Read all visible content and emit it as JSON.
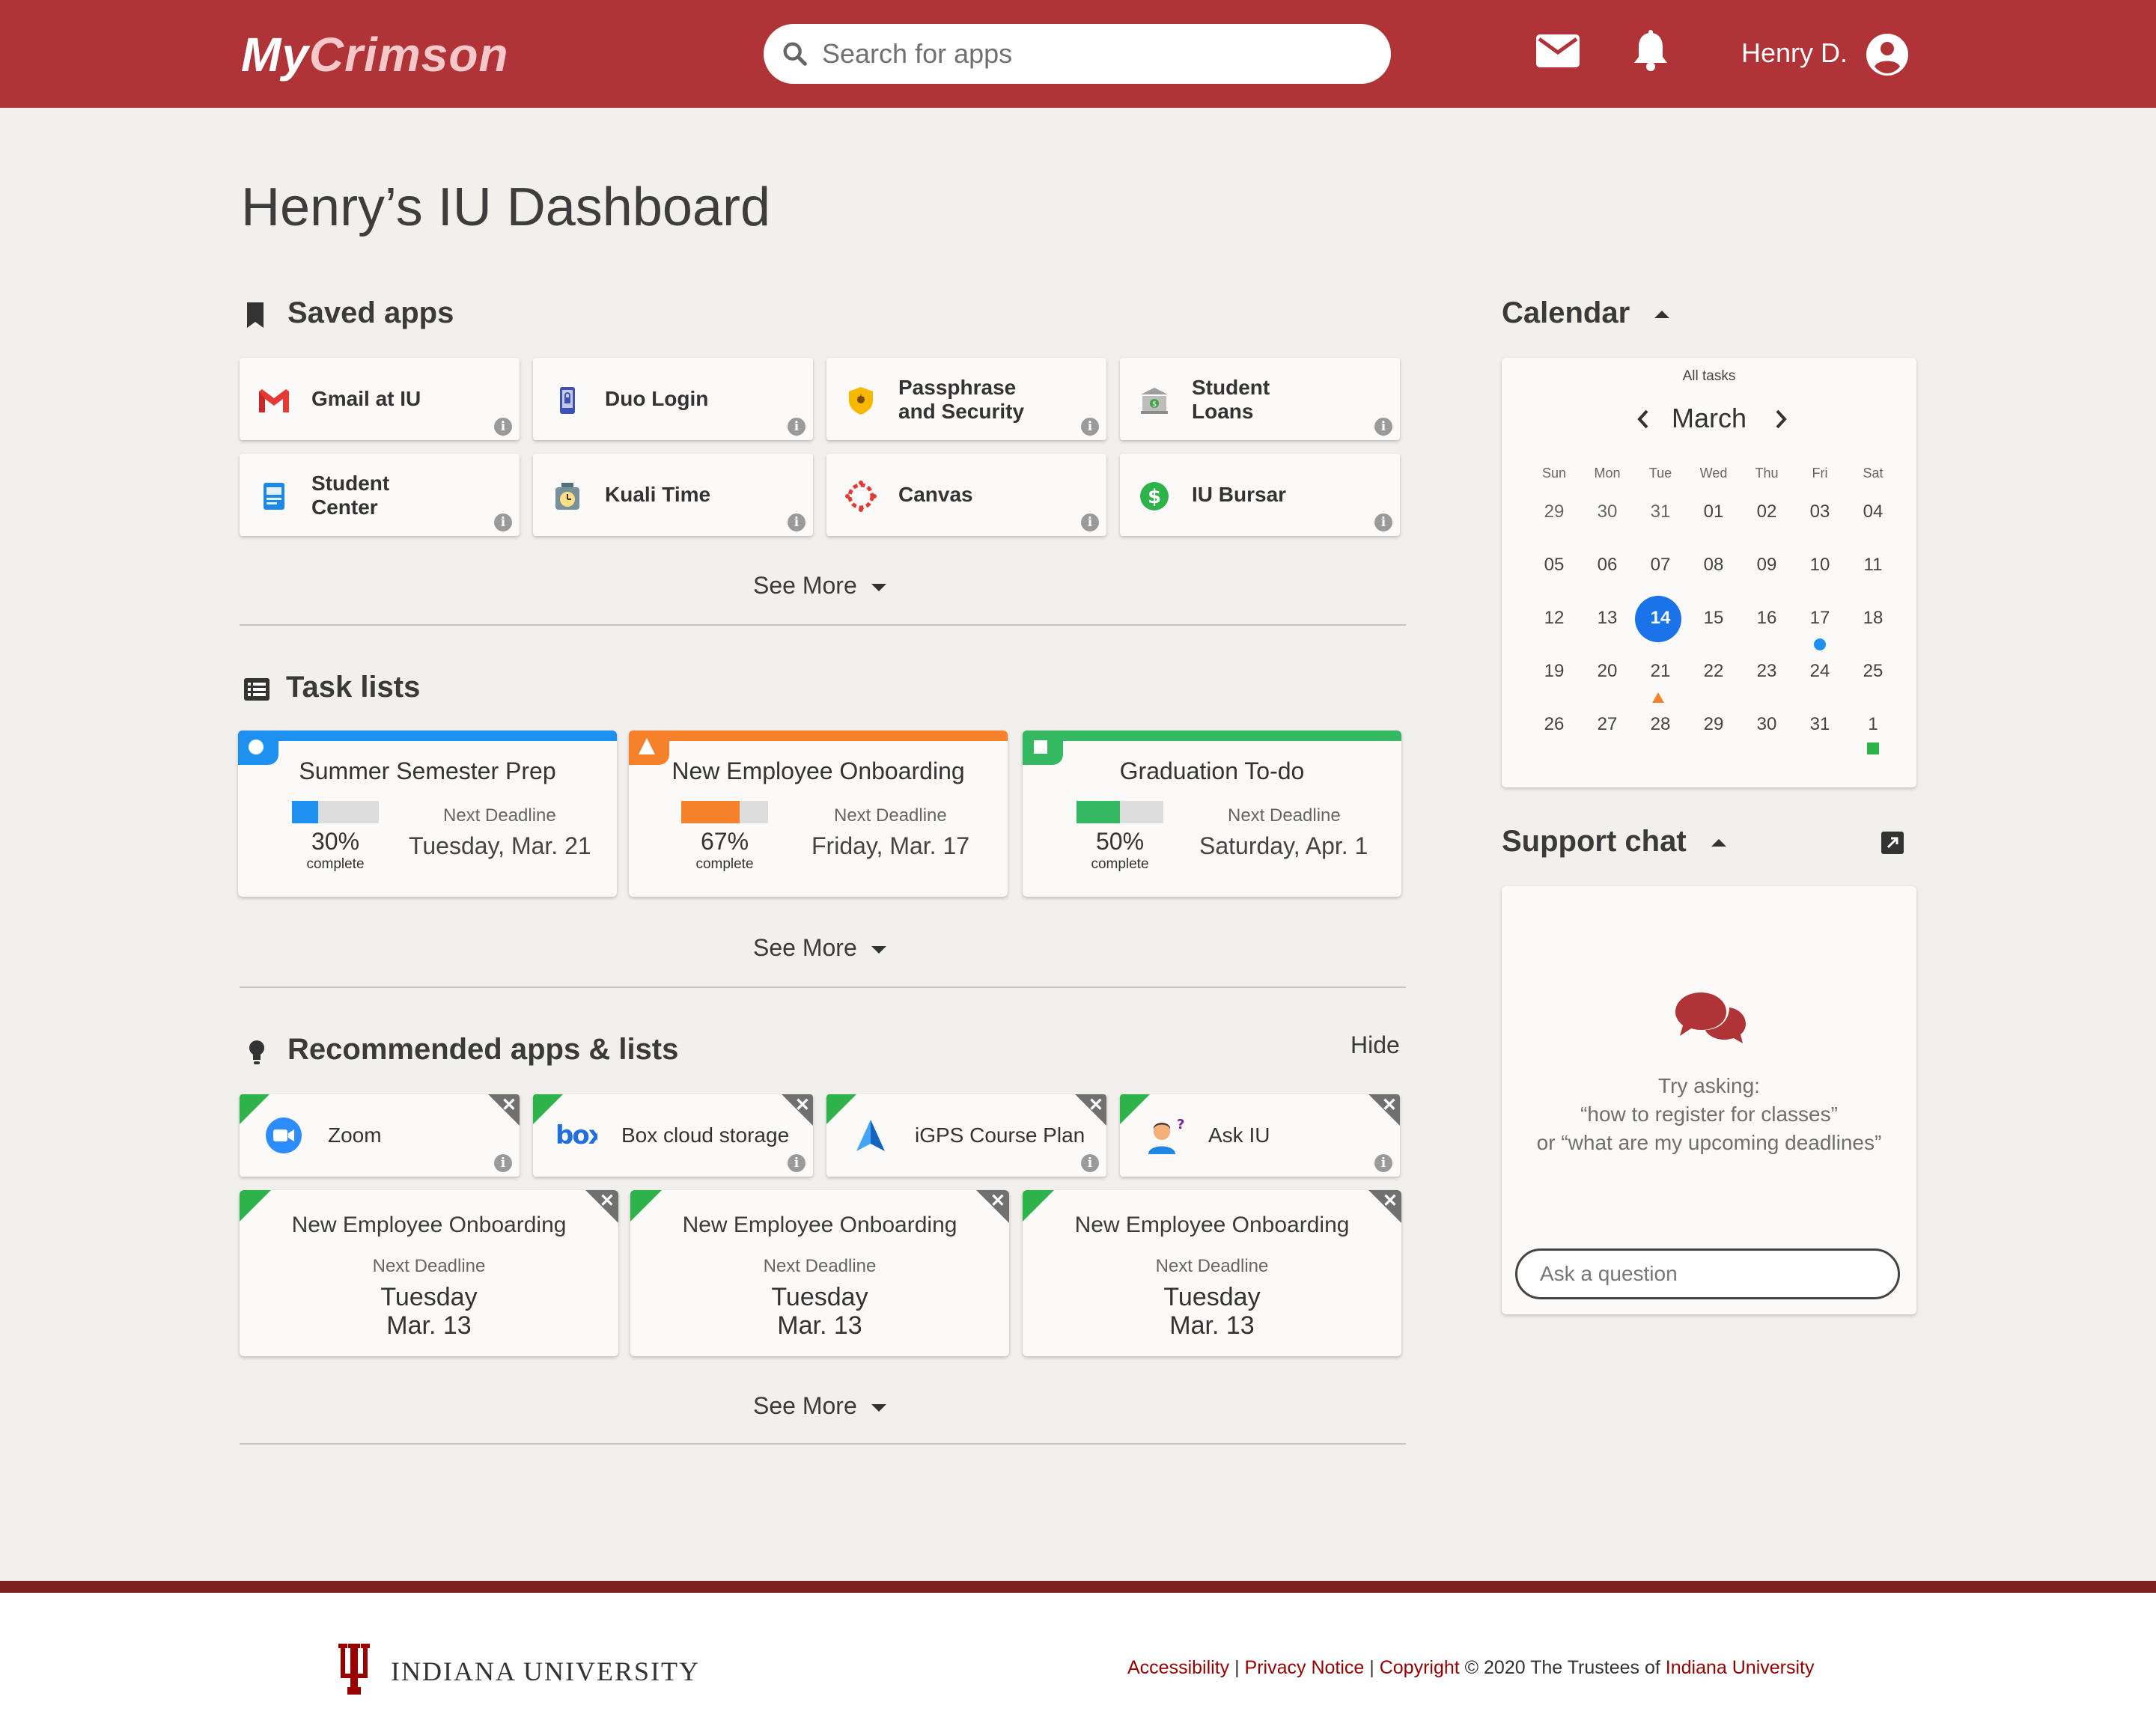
{
  "header": {
    "logo_my": "My",
    "logo_crimson": "Crimson",
    "search_placeholder": "Search for apps",
    "user_name": "Henry D."
  },
  "page_title": "Henry’s IU Dashboard",
  "saved_apps": {
    "heading": "Saved apps",
    "items": [
      {
        "label": "Gmail at IU",
        "icon": "gmail-icon"
      },
      {
        "label": "Duo Login",
        "icon": "duo-icon"
      },
      {
        "label": "Passphrase\nand Security",
        "icon": "shield-icon"
      },
      {
        "label": "Student\nLoans",
        "icon": "bank-icon"
      },
      {
        "label": "Student\nCenter",
        "icon": "student-center-icon"
      },
      {
        "label": "Kuali Time",
        "icon": "timer-icon"
      },
      {
        "label": "Canvas",
        "icon": "canvas-icon"
      },
      {
        "label": "IU Bursar",
        "icon": "dollar-icon"
      }
    ],
    "see_more": "See More"
  },
  "task_lists": {
    "heading": "Task lists",
    "items": [
      {
        "title": "Summer Semester Prep",
        "progress": 30,
        "pct": "30%",
        "complete": "complete",
        "next_label": "Next Deadline",
        "deadline": "Tuesday, Mar. 21",
        "color": "#1e90f0"
      },
      {
        "title": "New Employee Onboarding",
        "progress": 67,
        "pct": "67%",
        "complete": "complete",
        "next_label": "Next Deadline",
        "deadline": "Friday, Mar. 17",
        "color": "#f5822a"
      },
      {
        "title": "Graduation To-do",
        "progress": 50,
        "pct": "50%",
        "complete": "complete",
        "next_label": "Next Deadline",
        "deadline": "Saturday, Apr. 1",
        "color": "#35b862"
      }
    ],
    "see_more": "See More"
  },
  "recommended": {
    "heading": "Recommended apps & lists",
    "hide": "Hide",
    "apps": [
      {
        "label": "Zoom",
        "icon": "zoom-icon"
      },
      {
        "label": "Box cloud storage",
        "icon": "box-icon"
      },
      {
        "label": "iGPS Course Plan",
        "icon": "igps-icon"
      },
      {
        "label": "Ask IU",
        "icon": "ask-iu-icon"
      }
    ],
    "lists": [
      {
        "title": "New Employee Onboarding",
        "next_label": "Next Deadline",
        "day": "Tuesday",
        "date": "Mar. 13"
      },
      {
        "title": "New Employee Onboarding",
        "next_label": "Next Deadline",
        "day": "Tuesday",
        "date": "Mar. 13"
      },
      {
        "title": "New Employee Onboarding",
        "next_label": "Next Deadline",
        "day": "Tuesday",
        "date": "Mar. 13"
      }
    ],
    "see_more": "See More"
  },
  "calendar": {
    "heading": "Calendar",
    "filter": "All tasks",
    "month": "March",
    "weekdays": [
      "Sun",
      "Mon",
      "Tue",
      "Wed",
      "Thu",
      "Fri",
      "Sat"
    ],
    "weeks": [
      [
        "29",
        "30",
        "31",
        "01",
        "02",
        "03",
        "04"
      ],
      [
        "05",
        "06",
        "07",
        "08",
        "09",
        "10",
        "11"
      ],
      [
        "12",
        "13",
        "14",
        "15",
        "16",
        "17",
        "18"
      ],
      [
        "19",
        "20",
        "21",
        "22",
        "23",
        "24",
        "25"
      ],
      [
        "26",
        "27",
        "28",
        "29",
        "30",
        "31",
        "1"
      ]
    ],
    "today": "14"
  },
  "support_chat": {
    "heading": "Support chat",
    "try_asking": "Try asking:",
    "example_1": "“how to register for classes”",
    "example_2": "or “what are my upcoming deadlines”",
    "input_placeholder": "Ask a question"
  },
  "footer": {
    "university": "INDIANA UNIVERSITY",
    "link_accessibility": "Accessibility",
    "sep1": " | ",
    "link_privacy": "Privacy Notice",
    "sep2": " | ",
    "link_copyright": "Copyright",
    "copyright_text": " © 2020 The Trustees of ",
    "link_iu": "Indiana University"
  },
  "colors": {
    "brand": "#b03337",
    "background": "#f2f0ed",
    "today": "#1a73e8",
    "footer_bar": "#7c1f1f"
  }
}
